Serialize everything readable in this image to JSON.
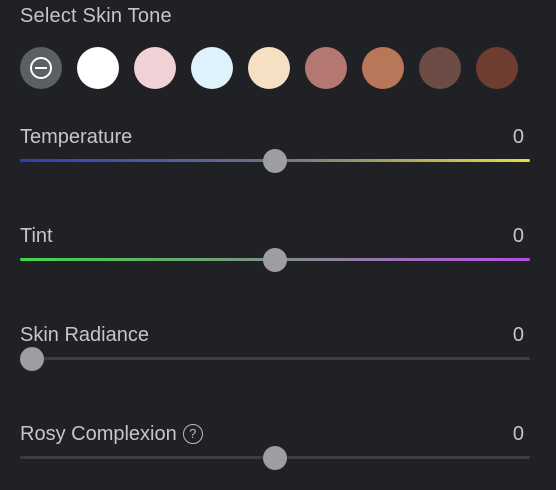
{
  "skin_tone": {
    "title": "Select Skin Tone",
    "none_icon": "no-color-icon",
    "swatches": [
      {
        "name": "white",
        "color": "#ffffff"
      },
      {
        "name": "pink",
        "color": "#efd1d6"
      },
      {
        "name": "light-blue",
        "color": "#dff2fb"
      },
      {
        "name": "peach",
        "color": "#f6e0c4"
      },
      {
        "name": "rose-brown",
        "color": "#b57771"
      },
      {
        "name": "terracotta",
        "color": "#b87758"
      },
      {
        "name": "dark-brown",
        "color": "#6d4c45"
      },
      {
        "name": "chestnut",
        "color": "#6e3e31"
      }
    ]
  },
  "sliders": {
    "temperature": {
      "label": "Temperature",
      "value": "0",
      "level": 0.5
    },
    "tint": {
      "label": "Tint",
      "value": "0",
      "level": 0.5
    },
    "skin_radiance": {
      "label": "Skin Radiance",
      "value": "0",
      "level": 0
    },
    "rosy_complexion": {
      "label": "Rosy Complexion",
      "value": "0",
      "level": 0.5,
      "help_icon": "?"
    }
  }
}
